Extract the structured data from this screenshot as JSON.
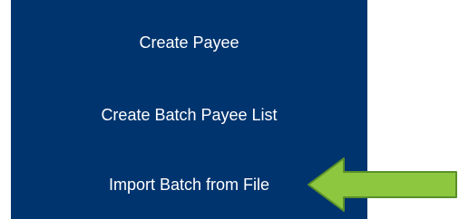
{
  "menu": {
    "items": [
      {
        "label": "Create Payee"
      },
      {
        "label": "Create Batch Payee List"
      },
      {
        "label": "Import Batch from File"
      }
    ]
  },
  "annotation": {
    "icon": "arrow-left-icon",
    "color": "#8dc63f",
    "outline_color": "#5a8f29"
  },
  "colors": {
    "panel_background": "#00346e",
    "menu_text": "#ffffff",
    "page_background": "#ffffff"
  }
}
